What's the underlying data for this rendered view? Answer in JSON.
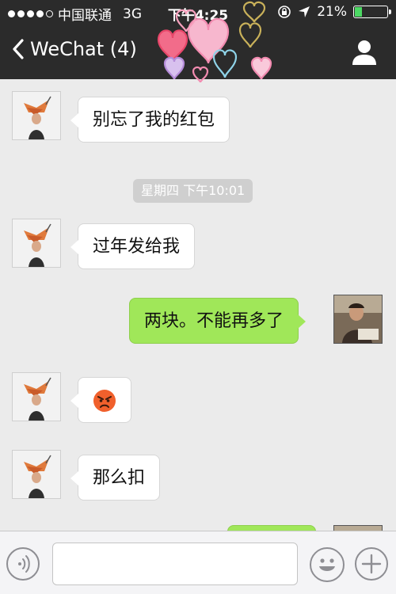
{
  "status_bar": {
    "carrier": "中国联通",
    "network": "3G",
    "time": "下午4:25",
    "battery_text": "21%",
    "battery_level": 0.21,
    "signal_bars": 4,
    "icons": [
      "signal-dots-icon",
      "orientation-lock-icon",
      "location-arrow-icon",
      "battery-icon"
    ]
  },
  "nav": {
    "back_label": "WeChat (4)",
    "back_icon": "chevron-left-icon",
    "profile_icon": "person-icon"
  },
  "messages": [
    {
      "side": "in",
      "text": "别忘了我的红包"
    },
    {
      "type": "timestamp",
      "text": "星期四 下午10:01"
    },
    {
      "side": "in",
      "text": "过年发给我"
    },
    {
      "side": "out",
      "text": "两块。不能再多了"
    },
    {
      "side": "in",
      "emoji": "angry-face-icon"
    },
    {
      "side": "in",
      "text": "那么扣"
    },
    {
      "side": "out",
      "text": ""
    }
  ],
  "input_bar": {
    "voice_icon": "voice-icon",
    "text_value": "",
    "emoji_icon": "smiley-icon",
    "more_icon": "plus-icon"
  },
  "colors": {
    "bar": "#2b2b2b",
    "background": "#ebebeb",
    "outgoing_bubble": "#a0e759",
    "incoming_bubble": "#ffffff",
    "battery": "#4cd964"
  }
}
